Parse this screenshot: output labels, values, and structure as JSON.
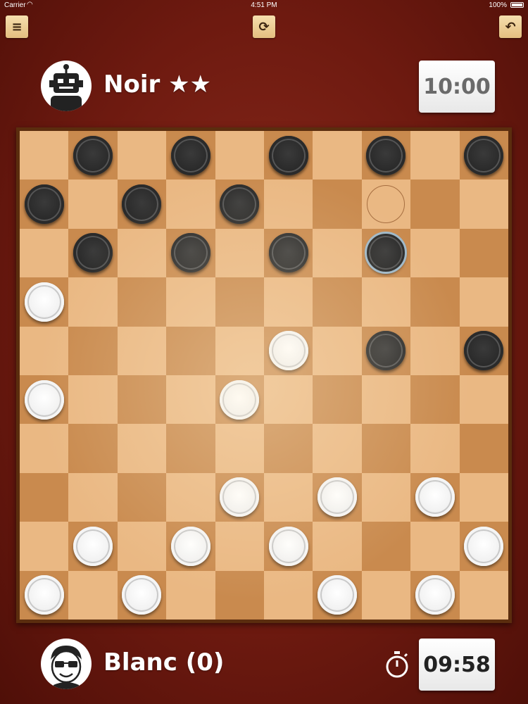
{
  "status_bar": {
    "carrier": "Carrier",
    "time": "4:51 PM",
    "battery": "100%"
  },
  "toolbar": {
    "menu_icon": "≡",
    "refresh_icon": "⟳",
    "undo_icon": "↶"
  },
  "opponent": {
    "name": "Noir ★★",
    "clock": "10:00",
    "clock_color": "#6a6a6a"
  },
  "player": {
    "name": "Blanc (0)",
    "clock": "09:58",
    "clock_color": "#222222"
  },
  "board": {
    "size": 10,
    "rows": [
      "_b_b_b_b_b",
      "b_b_b_ot__",
      "_b_b_b_s__",
      "w_________",
      "_____w_b_b",
      "w___w_____",
      "__________",
      "____w_w_w_",
      "_w_w_w___w",
      "w_w___w_w_"
    ],
    "legend": {
      "b": "black piece",
      "w": "white piece",
      "s": "selected black piece",
      "t": "move target"
    }
  },
  "colors": {
    "light_square": "#eab883",
    "dark_square": "#c98a4e",
    "background": "#6e1a10"
  }
}
